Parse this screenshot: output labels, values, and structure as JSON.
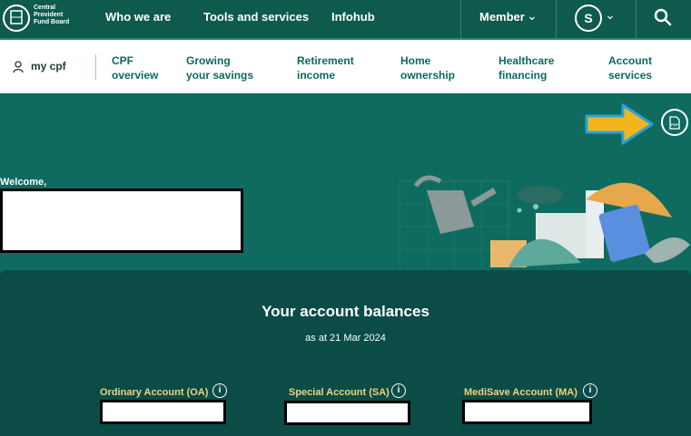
{
  "logo": {
    "lines": [
      "Central",
      "Provident",
      "Fund Board"
    ]
  },
  "topnav": {
    "items": [
      "Who we are",
      "Tools and services",
      "Infohub"
    ],
    "member_label": "Member",
    "avatar_letter": "S"
  },
  "subnav": {
    "mycpf": "my cpf",
    "items": [
      [
        "CPF",
        "overview"
      ],
      [
        "Growing",
        "your savings"
      ],
      [
        "Retirement",
        "income"
      ],
      [
        "Home",
        "ownership"
      ],
      [
        "Healthcare",
        "financing"
      ],
      [
        "Account",
        "services"
      ]
    ]
  },
  "hero": {
    "welcome": "Welcome,"
  },
  "balances": {
    "title": "Your account balances",
    "as_at": "as at 21 Mar 2024",
    "accounts": [
      "Ordinary Account (OA)",
      "Special Account (SA)",
      "MediSave Account (MA)"
    ]
  },
  "icons": {
    "pdf": "pdf-download-icon",
    "info": "info-icon",
    "search": "search-icon",
    "arrow": "yellow-arrow-annotation"
  },
  "colors": {
    "topbar": "#0e5a4c",
    "hero": "#0f6b60",
    "panel": "#0b4c47",
    "accent_gold": "#f2d27a",
    "nav_text": "#0d6a5b"
  }
}
